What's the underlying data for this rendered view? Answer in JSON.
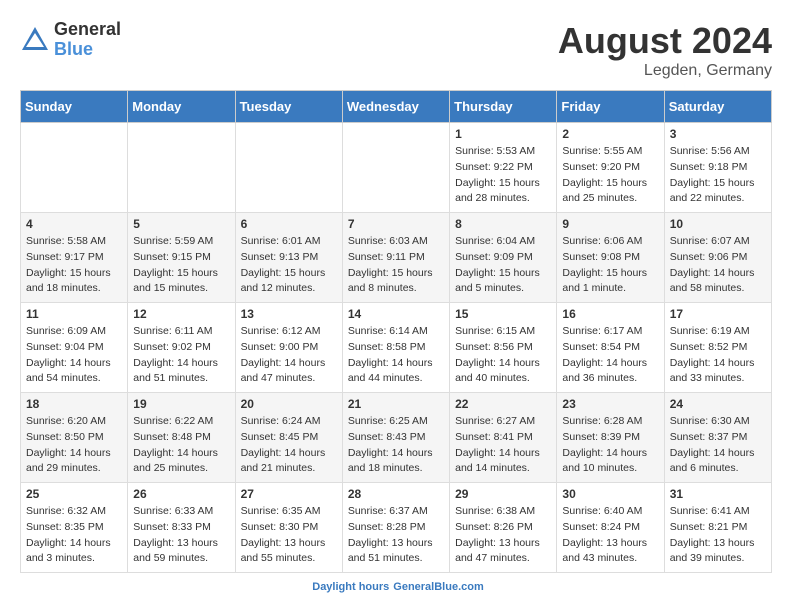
{
  "header": {
    "logo_general": "General",
    "logo_blue": "Blue",
    "month_year": "August 2024",
    "location": "Legden, Germany"
  },
  "footer": {
    "label": "Daylight hours"
  },
  "days_of_week": [
    "Sunday",
    "Monday",
    "Tuesday",
    "Wednesday",
    "Thursday",
    "Friday",
    "Saturday"
  ],
  "weeks": [
    [
      {
        "day": "",
        "sunrise": "",
        "sunset": "",
        "daylight": ""
      },
      {
        "day": "",
        "sunrise": "",
        "sunset": "",
        "daylight": ""
      },
      {
        "day": "",
        "sunrise": "",
        "sunset": "",
        "daylight": ""
      },
      {
        "day": "",
        "sunrise": "",
        "sunset": "",
        "daylight": ""
      },
      {
        "day": "1",
        "sunrise": "Sunrise: 5:53 AM",
        "sunset": "Sunset: 9:22 PM",
        "daylight": "Daylight: 15 hours and 28 minutes."
      },
      {
        "day": "2",
        "sunrise": "Sunrise: 5:55 AM",
        "sunset": "Sunset: 9:20 PM",
        "daylight": "Daylight: 15 hours and 25 minutes."
      },
      {
        "day": "3",
        "sunrise": "Sunrise: 5:56 AM",
        "sunset": "Sunset: 9:18 PM",
        "daylight": "Daylight: 15 hours and 22 minutes."
      }
    ],
    [
      {
        "day": "4",
        "sunrise": "Sunrise: 5:58 AM",
        "sunset": "Sunset: 9:17 PM",
        "daylight": "Daylight: 15 hours and 18 minutes."
      },
      {
        "day": "5",
        "sunrise": "Sunrise: 5:59 AM",
        "sunset": "Sunset: 9:15 PM",
        "daylight": "Daylight: 15 hours and 15 minutes."
      },
      {
        "day": "6",
        "sunrise": "Sunrise: 6:01 AM",
        "sunset": "Sunset: 9:13 PM",
        "daylight": "Daylight: 15 hours and 12 minutes."
      },
      {
        "day": "7",
        "sunrise": "Sunrise: 6:03 AM",
        "sunset": "Sunset: 9:11 PM",
        "daylight": "Daylight: 15 hours and 8 minutes."
      },
      {
        "day": "8",
        "sunrise": "Sunrise: 6:04 AM",
        "sunset": "Sunset: 9:09 PM",
        "daylight": "Daylight: 15 hours and 5 minutes."
      },
      {
        "day": "9",
        "sunrise": "Sunrise: 6:06 AM",
        "sunset": "Sunset: 9:08 PM",
        "daylight": "Daylight: 15 hours and 1 minute."
      },
      {
        "day": "10",
        "sunrise": "Sunrise: 6:07 AM",
        "sunset": "Sunset: 9:06 PM",
        "daylight": "Daylight: 14 hours and 58 minutes."
      }
    ],
    [
      {
        "day": "11",
        "sunrise": "Sunrise: 6:09 AM",
        "sunset": "Sunset: 9:04 PM",
        "daylight": "Daylight: 14 hours and 54 minutes."
      },
      {
        "day": "12",
        "sunrise": "Sunrise: 6:11 AM",
        "sunset": "Sunset: 9:02 PM",
        "daylight": "Daylight: 14 hours and 51 minutes."
      },
      {
        "day": "13",
        "sunrise": "Sunrise: 6:12 AM",
        "sunset": "Sunset: 9:00 PM",
        "daylight": "Daylight: 14 hours and 47 minutes."
      },
      {
        "day": "14",
        "sunrise": "Sunrise: 6:14 AM",
        "sunset": "Sunset: 8:58 PM",
        "daylight": "Daylight: 14 hours and 44 minutes."
      },
      {
        "day": "15",
        "sunrise": "Sunrise: 6:15 AM",
        "sunset": "Sunset: 8:56 PM",
        "daylight": "Daylight: 14 hours and 40 minutes."
      },
      {
        "day": "16",
        "sunrise": "Sunrise: 6:17 AM",
        "sunset": "Sunset: 8:54 PM",
        "daylight": "Daylight: 14 hours and 36 minutes."
      },
      {
        "day": "17",
        "sunrise": "Sunrise: 6:19 AM",
        "sunset": "Sunset: 8:52 PM",
        "daylight": "Daylight: 14 hours and 33 minutes."
      }
    ],
    [
      {
        "day": "18",
        "sunrise": "Sunrise: 6:20 AM",
        "sunset": "Sunset: 8:50 PM",
        "daylight": "Daylight: 14 hours and 29 minutes."
      },
      {
        "day": "19",
        "sunrise": "Sunrise: 6:22 AM",
        "sunset": "Sunset: 8:48 PM",
        "daylight": "Daylight: 14 hours and 25 minutes."
      },
      {
        "day": "20",
        "sunrise": "Sunrise: 6:24 AM",
        "sunset": "Sunset: 8:45 PM",
        "daylight": "Daylight: 14 hours and 21 minutes."
      },
      {
        "day": "21",
        "sunrise": "Sunrise: 6:25 AM",
        "sunset": "Sunset: 8:43 PM",
        "daylight": "Daylight: 14 hours and 18 minutes."
      },
      {
        "day": "22",
        "sunrise": "Sunrise: 6:27 AM",
        "sunset": "Sunset: 8:41 PM",
        "daylight": "Daylight: 14 hours and 14 minutes."
      },
      {
        "day": "23",
        "sunrise": "Sunrise: 6:28 AM",
        "sunset": "Sunset: 8:39 PM",
        "daylight": "Daylight: 14 hours and 10 minutes."
      },
      {
        "day": "24",
        "sunrise": "Sunrise: 6:30 AM",
        "sunset": "Sunset: 8:37 PM",
        "daylight": "Daylight: 14 hours and 6 minutes."
      }
    ],
    [
      {
        "day": "25",
        "sunrise": "Sunrise: 6:32 AM",
        "sunset": "Sunset: 8:35 PM",
        "daylight": "Daylight: 14 hours and 3 minutes."
      },
      {
        "day": "26",
        "sunrise": "Sunrise: 6:33 AM",
        "sunset": "Sunset: 8:33 PM",
        "daylight": "Daylight: 13 hours and 59 minutes."
      },
      {
        "day": "27",
        "sunrise": "Sunrise: 6:35 AM",
        "sunset": "Sunset: 8:30 PM",
        "daylight": "Daylight: 13 hours and 55 minutes."
      },
      {
        "day": "28",
        "sunrise": "Sunrise: 6:37 AM",
        "sunset": "Sunset: 8:28 PM",
        "daylight": "Daylight: 13 hours and 51 minutes."
      },
      {
        "day": "29",
        "sunrise": "Sunrise: 6:38 AM",
        "sunset": "Sunset: 8:26 PM",
        "daylight": "Daylight: 13 hours and 47 minutes."
      },
      {
        "day": "30",
        "sunrise": "Sunrise: 6:40 AM",
        "sunset": "Sunset: 8:24 PM",
        "daylight": "Daylight: 13 hours and 43 minutes."
      },
      {
        "day": "31",
        "sunrise": "Sunrise: 6:41 AM",
        "sunset": "Sunset: 8:21 PM",
        "daylight": "Daylight: 13 hours and 39 minutes."
      }
    ]
  ]
}
